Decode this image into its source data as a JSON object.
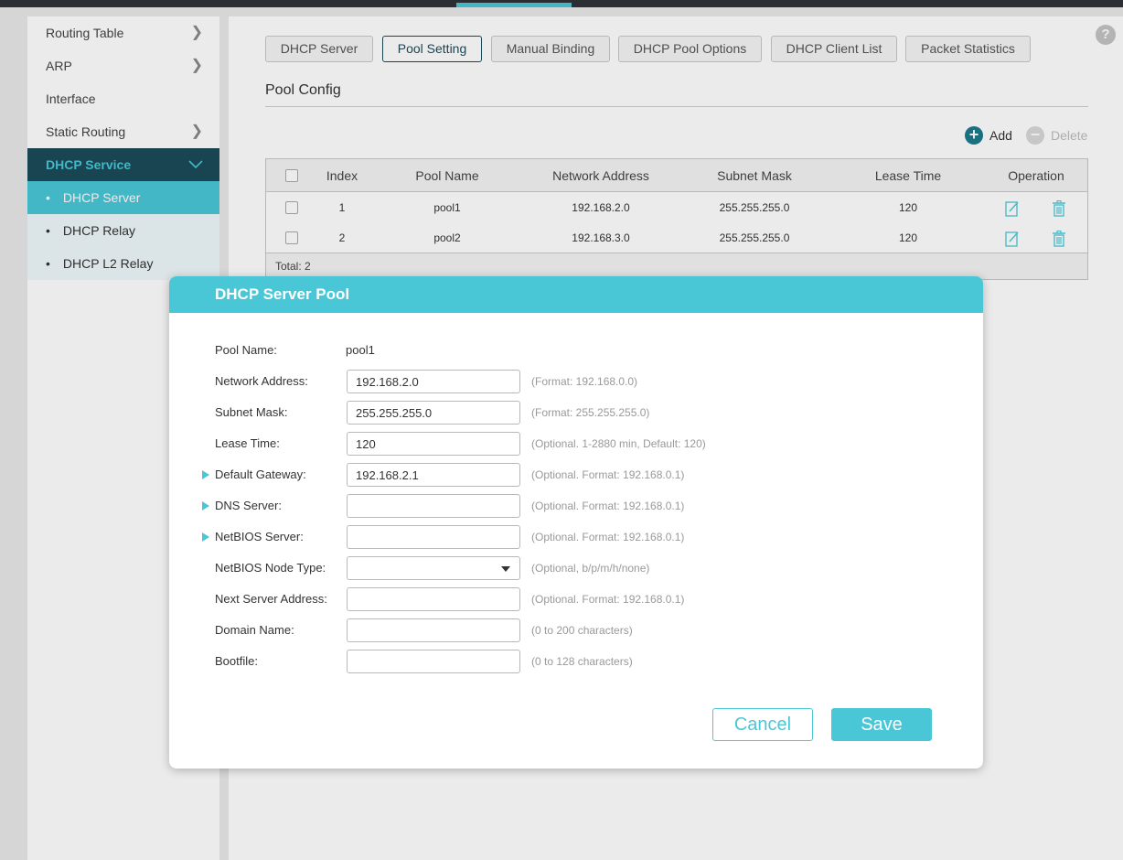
{
  "sidebar": {
    "items": [
      {
        "label": "Routing Table"
      },
      {
        "label": "ARP"
      },
      {
        "label": "Interface"
      },
      {
        "label": "Static Routing"
      }
    ],
    "group": {
      "label": "DHCP Service"
    },
    "sub_items": [
      {
        "label": "DHCP Server"
      },
      {
        "label": "DHCP Relay"
      },
      {
        "label": "DHCP L2 Relay"
      }
    ]
  },
  "help": {
    "label": "?"
  },
  "tabs": [
    {
      "label": "DHCP Server"
    },
    {
      "label": "Pool Setting"
    },
    {
      "label": "Manual Binding"
    },
    {
      "label": "DHCP Pool Options"
    },
    {
      "label": "DHCP Client List"
    },
    {
      "label": "Packet Statistics"
    }
  ],
  "pool_config": {
    "title": "Pool Config",
    "add_label": "Add",
    "delete_label": "Delete",
    "columns": [
      "Index",
      "Pool Name",
      "Network Address",
      "Subnet Mask",
      "Lease Time",
      "Operation"
    ],
    "rows": [
      {
        "index": "1",
        "name": "pool1",
        "network": "192.168.2.0",
        "mask": "255.255.255.0",
        "lease": "120"
      },
      {
        "index": "2",
        "name": "pool2",
        "network": "192.168.3.0",
        "mask": "255.255.255.0",
        "lease": "120"
      }
    ],
    "total": "Total: 2"
  },
  "dialog": {
    "title": "DHCP Server Pool",
    "pool_name_label": "Pool Name:",
    "pool_name_value": "pool1",
    "fields": {
      "network": {
        "label": "Network Address:",
        "value": "192.168.2.0",
        "hint": "(Format: 192.168.0.0)"
      },
      "mask": {
        "label": "Subnet Mask:",
        "value": "255.255.255.0",
        "hint": "(Format: 255.255.255.0)"
      },
      "lease": {
        "label": "Lease Time:",
        "value": "120",
        "hint": "(Optional. 1-2880 min, Default: 120)"
      },
      "gateway": {
        "label": "Default Gateway:",
        "value": "192.168.2.1",
        "hint": "(Optional. Format: 192.168.0.1)"
      },
      "dns": {
        "label": "DNS Server:",
        "value": "",
        "hint": "(Optional. Format: 192.168.0.1)"
      },
      "netbios_server": {
        "label": "NetBIOS Server:",
        "value": "",
        "hint": "(Optional. Format: 192.168.0.1)"
      },
      "netbios_node": {
        "label": "NetBIOS Node Type:",
        "value": "",
        "hint": "(Optional, b/p/m/h/none)"
      },
      "next_server": {
        "label": "Next Server Address:",
        "value": "",
        "hint": "(Optional. Format: 192.168.0.1)"
      },
      "domain": {
        "label": "Domain Name:",
        "value": "",
        "hint": "(0 to 200 characters)"
      },
      "bootfile": {
        "label": "Bootfile:",
        "value": "",
        "hint": "(0 to 128 characters)"
      }
    },
    "cancel_label": "Cancel",
    "save_label": "Save"
  },
  "colors": {
    "accent": "#49c7d6",
    "dark": "#1c4b5a"
  },
  "icons": [
    "chevron-right-icon",
    "chevron-down-icon",
    "add-icon",
    "delete-icon",
    "edit-icon",
    "trash-icon",
    "help-icon",
    "expand-marker-icon",
    "dropdown-caret-icon"
  ]
}
